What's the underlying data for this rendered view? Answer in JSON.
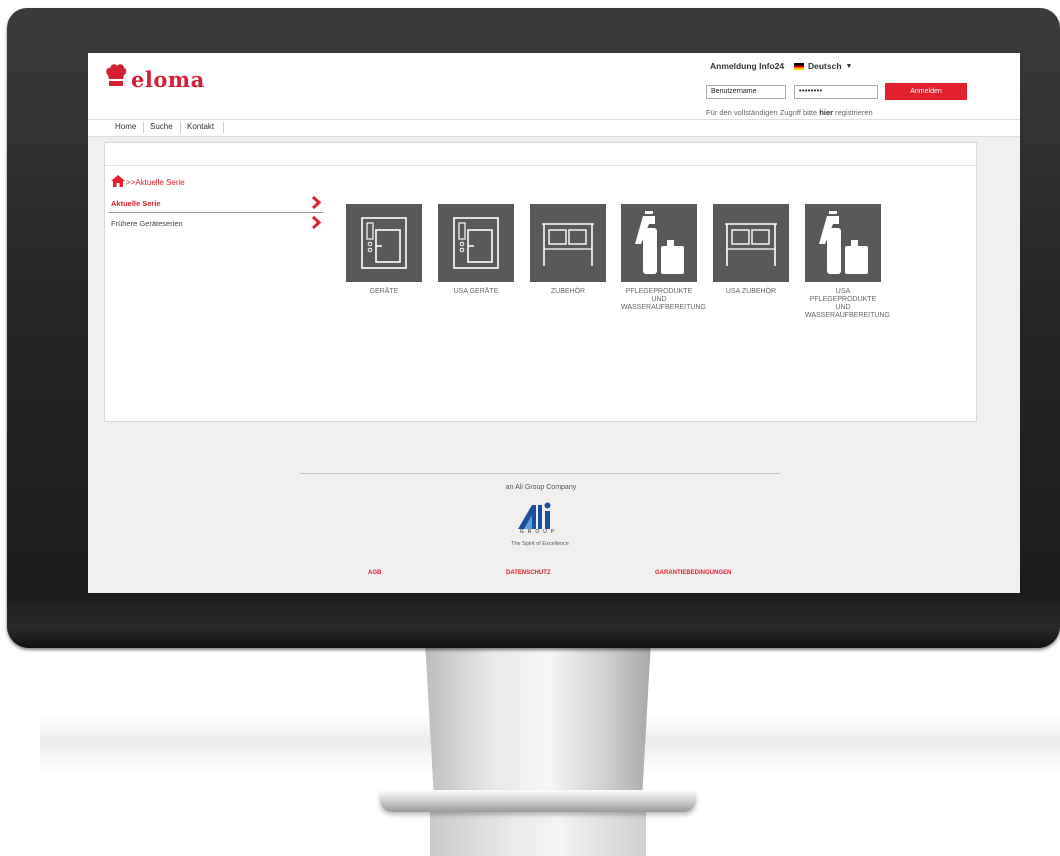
{
  "brand": {
    "name": "eloma",
    "color": "#d51f35"
  },
  "login": {
    "title": "Anmeldung Info24",
    "language": "Deutsch",
    "username_value": "Benutzername",
    "password_value": "••••••••",
    "submit_label": "Anmelden",
    "register_prefix": "Für den vollständigen Zugriff bitte",
    "register_link": "hier",
    "register_suffix": "registrieren"
  },
  "nav": [
    "Home",
    "Suche",
    "Kontakt"
  ],
  "breadcrumb": {
    "separator": ">>",
    "current": "Aktuelle Serie"
  },
  "sidebar": [
    {
      "label": "Aktuelle Serie",
      "active": true
    },
    {
      "label": "Frühere Geräteserien",
      "active": false
    }
  ],
  "tiles": [
    {
      "label": "GERÄTE",
      "icon": "oven-icon"
    },
    {
      "label": "USA GERÄTE",
      "icon": "oven-icon"
    },
    {
      "label": "ZUBEHÖR",
      "icon": "rack-icon"
    },
    {
      "label": "PFLEGEPRODUKTE\nUND\nWASSERAUFBEREITUNG",
      "icon": "cleaning-products-icon"
    },
    {
      "label": "USA ZUBEHÖR",
      "icon": "rack-icon"
    },
    {
      "label": "USA\nPFLEGEPRODUKTE\nUND\nWASSERAUFBEREITUNG",
      "icon": "cleaning-products-icon"
    }
  ],
  "footer": {
    "company": "an Ali Group Company",
    "group_word": "GROUP",
    "slogan": "The Spirit of Excellence",
    "links": [
      "AGB",
      "DATENSCHUTZ",
      "GARANTIEBEDINGUNGEN"
    ]
  },
  "colors": {
    "accent": "#e3202e",
    "tile": "#58595b",
    "screen_bg": "#f0f0ef"
  }
}
